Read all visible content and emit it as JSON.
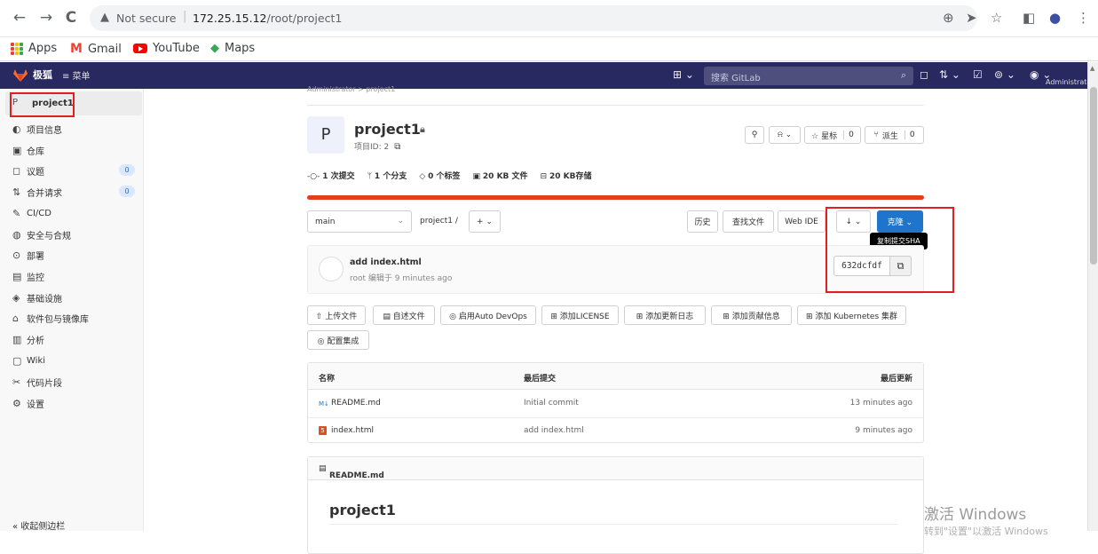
{
  "browser": {
    "back": "←",
    "forward": "→",
    "reload": "C",
    "security_label": "Not secure",
    "url_host": "172.25.15.12",
    "url_path": "/root/project1",
    "bookmarks": [
      {
        "label": "Apps"
      },
      {
        "label": "Gmail"
      },
      {
        "label": "YouTube"
      },
      {
        "label": "Maps"
      }
    ]
  },
  "gitlab_bar": {
    "brand": "极狐",
    "menu_label": "≡ 菜单",
    "search_placeholder": "搜索 GitLab",
    "user_label": "Administrator"
  },
  "sidebar": {
    "project_avatar": "P",
    "project_name": "project1",
    "items": [
      {
        "icon": "◐",
        "label": "项目信息"
      },
      {
        "icon": "▣",
        "label": "仓库"
      },
      {
        "icon": "◻",
        "label": "议题",
        "badge": "0"
      },
      {
        "icon": "⇅",
        "label": "合并请求",
        "badge": "0"
      },
      {
        "icon": "✎",
        "label": "CI/CD"
      },
      {
        "icon": "◍",
        "label": "安全与合规"
      },
      {
        "icon": "⊙",
        "label": "部署"
      },
      {
        "icon": "▤",
        "label": "监控"
      },
      {
        "icon": "◈",
        "label": "基础设施"
      },
      {
        "icon": "⌂",
        "label": "软件包与镜像库"
      },
      {
        "icon": "▥",
        "label": "分析"
      },
      {
        "icon": "▢",
        "label": "Wiki"
      },
      {
        "icon": "✂",
        "label": "代码片段"
      },
      {
        "icon": "⚙",
        "label": "设置"
      }
    ],
    "collapse_label": "« 收起侧边栏"
  },
  "project": {
    "breadcrumb": "Administrator > project1",
    "avatar_letter": "P",
    "title": "project1",
    "id_label": "项目ID: 2",
    "star_label": "☆ 星标",
    "star_count": "0",
    "fork_label": "派生",
    "fork_count": "0",
    "stats": [
      {
        "icon": "-○-",
        "text": "1 次提交"
      },
      {
        "icon": "ᛘ",
        "text": "1 个分支"
      },
      {
        "icon": "◇",
        "text": "0 个标签"
      },
      {
        "icon": "▣",
        "text": "20 KB 文件"
      },
      {
        "icon": "⊟",
        "text": "20 KB存储"
      }
    ]
  },
  "repo_toolbar": {
    "branch": "main",
    "path": "project1 /",
    "add_label": "+ ⌄",
    "history": "历史",
    "find_file": "查找文件",
    "web_ide": "Web IDE",
    "download": "↓ ⌄",
    "clone": "克隆 ⌄"
  },
  "last_commit": {
    "title": "add index.html",
    "meta": "root 编辑于 9 minutes ago",
    "sha": "632dcfdf",
    "copy_tooltip": "复制提交SHA"
  },
  "quick_actions": [
    "⇧ 上传文件",
    "▤ 自述文件",
    "◎ 启用Auto DevOps",
    "⊞ 添加LICENSE",
    "⊞ 添加更新日志",
    "⊞ 添加贡献信息",
    "⊞ 添加 Kubernetes 集群",
    "◎ 配置集成"
  ],
  "file_table": {
    "headers": [
      "名称",
      "最后提交",
      "最后更新"
    ],
    "rows": [
      {
        "icon": "M↓",
        "name": "README.md",
        "commit": "Initial commit",
        "updated": "13 minutes ago"
      },
      {
        "icon": "5",
        "name": "index.html",
        "commit": "add index.html",
        "updated": "9 minutes ago"
      }
    ]
  },
  "readme": {
    "header": "README.md",
    "heading": "project1"
  },
  "os_watermark": {
    "line1": "激活 Windows",
    "line2": "转到\"设置\"以激活 Windows"
  },
  "colors": {
    "gitlab_bar": "#292961",
    "clone_button": "#1f75cb",
    "annotation": "#e02020",
    "progress": "#e2401a"
  }
}
